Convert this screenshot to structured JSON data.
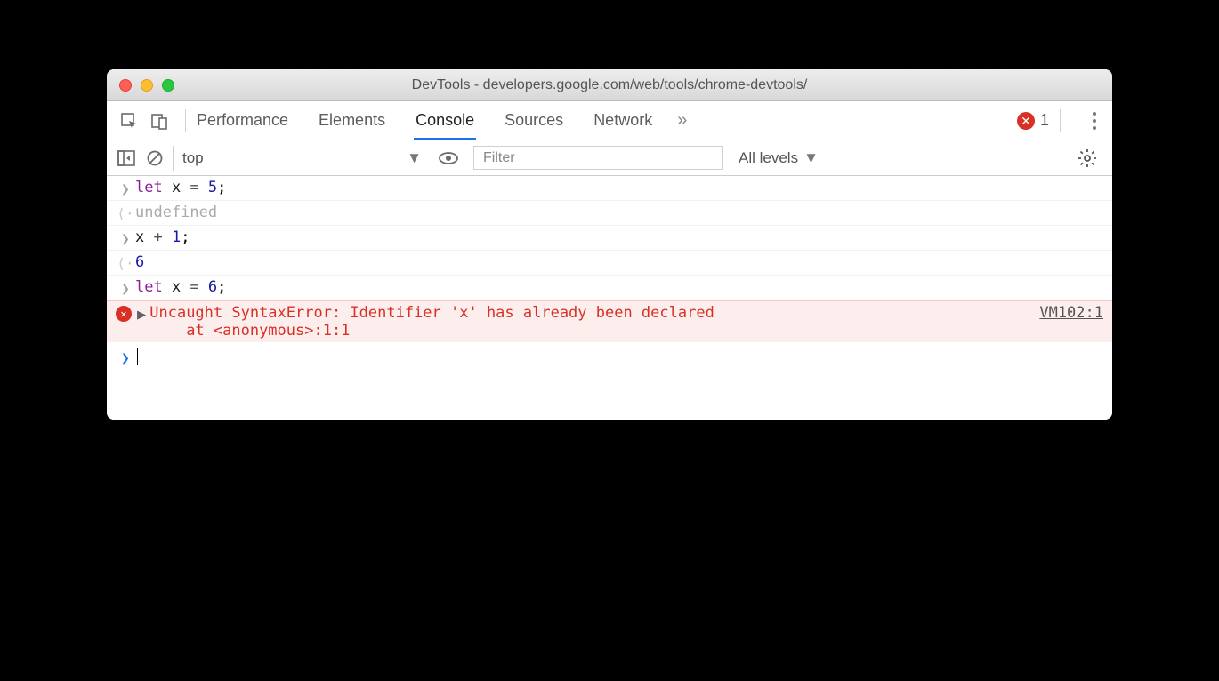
{
  "window": {
    "title": "DevTools - developers.google.com/web/tools/chrome-devtools/"
  },
  "tabs": {
    "items": [
      "Performance",
      "Elements",
      "Console",
      "Sources",
      "Network"
    ],
    "active_index": 2,
    "more_glyph": "»",
    "error_count": "1"
  },
  "filterbar": {
    "context": "top",
    "filter_placeholder": "Filter",
    "levels": "All levels"
  },
  "console": {
    "l0": {
      "kw": "let",
      "var": " x ",
      "op": "= ",
      "num": "5",
      "semi": ";"
    },
    "r0": "undefined",
    "l1": {
      "var": "x ",
      "op": "+ ",
      "num": "1",
      "semi": ";"
    },
    "r1": "6",
    "l2": {
      "kw": "let",
      "var": " x ",
      "op": "= ",
      "num": "6",
      "semi": ";"
    },
    "err": {
      "text": "Uncaught SyntaxError: Identifier 'x' has already been declared\n    at <anonymous>:1:1",
      "source": "VM102:1"
    }
  }
}
